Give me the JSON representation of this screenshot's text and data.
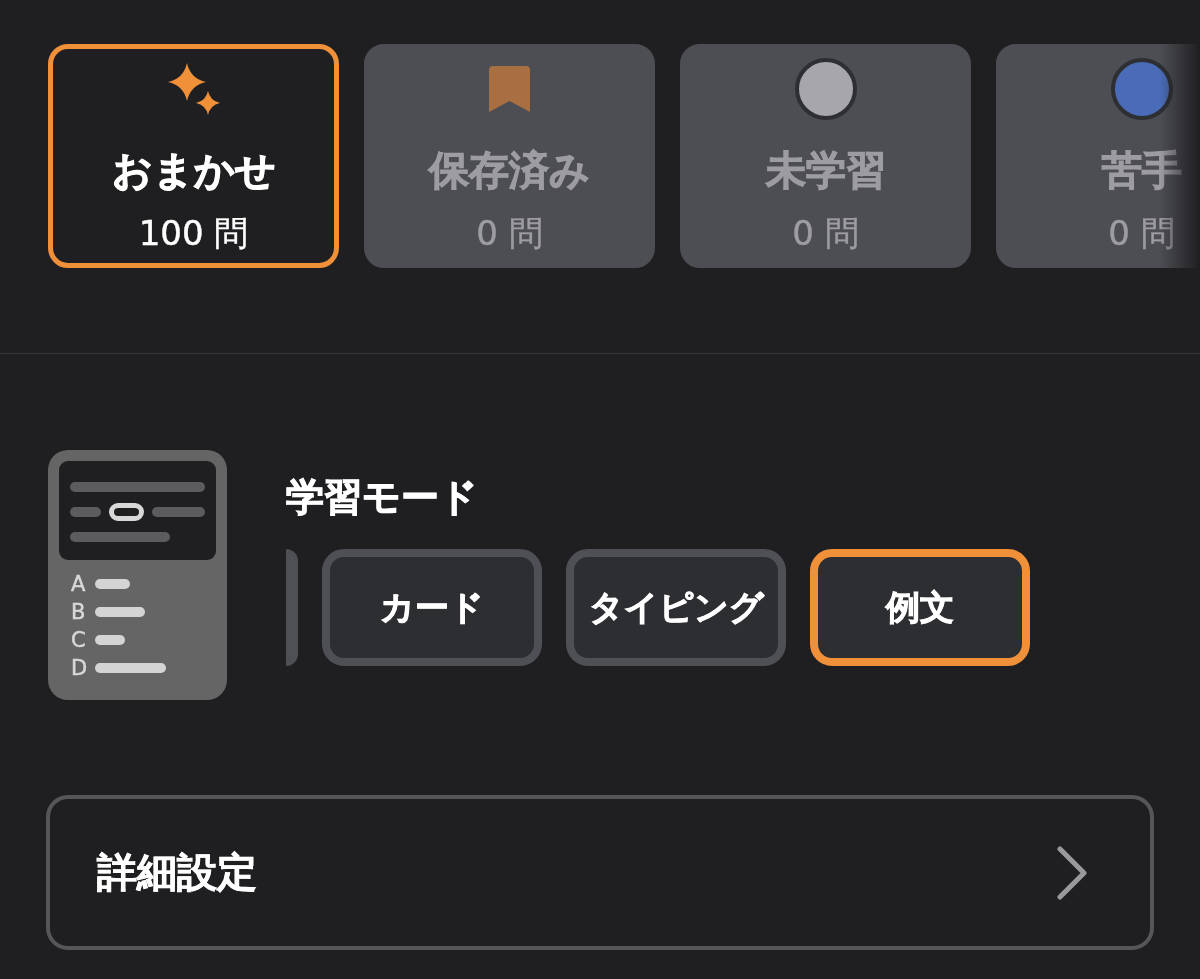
{
  "categories": [
    {
      "kind": "sparkle",
      "title": "おまかせ",
      "count": "100 問",
      "selected": true,
      "disabled": false
    },
    {
      "kind": "bookmark",
      "title": "保存済み",
      "count": "0 問",
      "selected": false,
      "disabled": true
    },
    {
      "kind": "dot",
      "color": "#a6a6ab",
      "title": "未学習",
      "count": "0 問",
      "selected": false,
      "disabled": true
    },
    {
      "kind": "dot",
      "color": "#4a6cb8",
      "title": "苦手",
      "count": "0 問",
      "selected": false,
      "disabled": true
    }
  ],
  "study_mode": {
    "title": "学習モード",
    "illustration": {
      "options": [
        "A",
        "B",
        "C",
        "D"
      ]
    },
    "modes": [
      {
        "kind": "clipped",
        "selected": false
      },
      {
        "kind": "full",
        "label": "カード",
        "selected": false
      },
      {
        "kind": "full",
        "label": "タイピング",
        "selected": false
      },
      {
        "kind": "full",
        "label": "例文",
        "selected": true
      }
    ]
  },
  "settings_row": {
    "label": "詳細設定"
  }
}
